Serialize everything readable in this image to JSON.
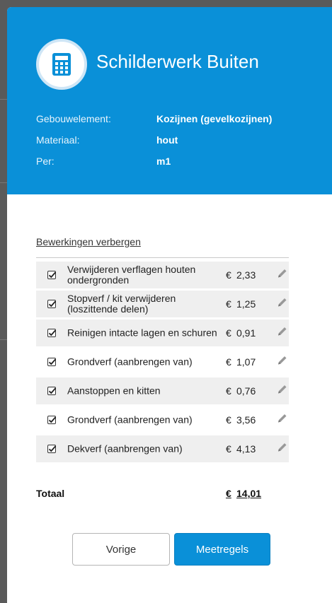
{
  "header": {
    "title": "Schilderwerk Buiten",
    "icon": "calculator-icon",
    "info": [
      {
        "label": "Gebouwelement:",
        "value": "Kozijnen (gevelkozijnen)"
      },
      {
        "label": "Materiaal:",
        "value": "hout"
      },
      {
        "label": "Per:",
        "value": "m1"
      }
    ]
  },
  "toggle_link": "Bewerkingen verbergen",
  "operations": [
    {
      "label": "Verwijderen verflagen houten ondergronden",
      "currency": "€",
      "price": "2,33",
      "checked": true
    },
    {
      "label": "Stopverf / kit verwijderen (loszittende delen)",
      "currency": "€",
      "price": "1,25",
      "checked": true
    },
    {
      "label": "Reinigen intacte lagen en schuren",
      "currency": "€",
      "price": "0,91",
      "checked": true
    },
    {
      "label": "Grondverf (aanbrengen van)",
      "currency": "€",
      "price": "1,07",
      "checked": true
    },
    {
      "label": "Aanstoppen en kitten",
      "currency": "€",
      "price": "0,76",
      "checked": true
    },
    {
      "label": "Grondverf (aanbrengen van)",
      "currency": "€",
      "price": "3,56",
      "checked": true
    },
    {
      "label": "Dekverf (aanbrengen van)",
      "currency": "€",
      "price": "4,13",
      "checked": true
    }
  ],
  "total": {
    "label": "Totaal",
    "currency": "€",
    "value": "14,01"
  },
  "buttons": {
    "previous": "Vorige",
    "next": "Meetregels"
  },
  "colors": {
    "accent": "#0a90d8",
    "row_shade": "#efefef"
  }
}
